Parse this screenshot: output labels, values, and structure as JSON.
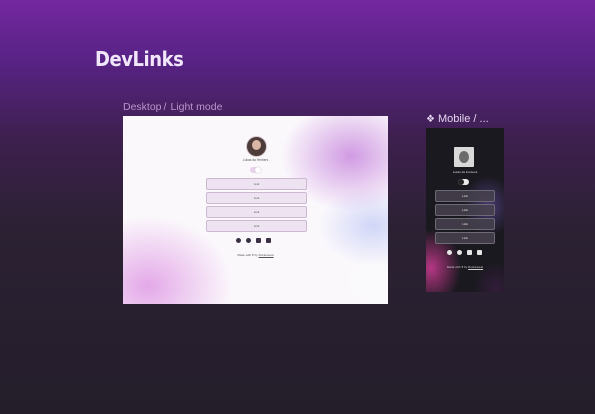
{
  "canvas": {
    "title": "DevLinks"
  },
  "desktop_frame": {
    "label_group": "Desktop",
    "label_separator": "/",
    "label_name": "Light mode",
    "profile_name": "Lukas da Yenbers",
    "buttons": [
      "Link",
      "Link",
      "Link",
      "Link"
    ],
    "social_icons": [
      "github-icon",
      "instagram-icon",
      "youtube-icon",
      "linkedin-icon"
    ],
    "footer_prefix": "Made with",
    "footer_heart": "♥",
    "footer_by": "by",
    "footer_link": "Rocketseat"
  },
  "mobile_frame": {
    "label_icon": "component-icon",
    "label_icon_glyph": "❖",
    "label": "Mobile / ...",
    "profile_name": "Lukas da Fonseca",
    "buttons": [
      "Link",
      "Link",
      "Link",
      "Link"
    ],
    "social_icons": [
      "github-icon",
      "instagram-icon",
      "youtube-icon",
      "linkedin-icon"
    ],
    "footer_prefix": "Made with",
    "footer_heart": "♥",
    "footer_by": "by",
    "footer_link": "Rocketseat"
  },
  "colors": {
    "background_top": "#74279f",
    "background_bottom": "#241d2a",
    "title": "#f1e6fa",
    "label": "#b896cc"
  }
}
